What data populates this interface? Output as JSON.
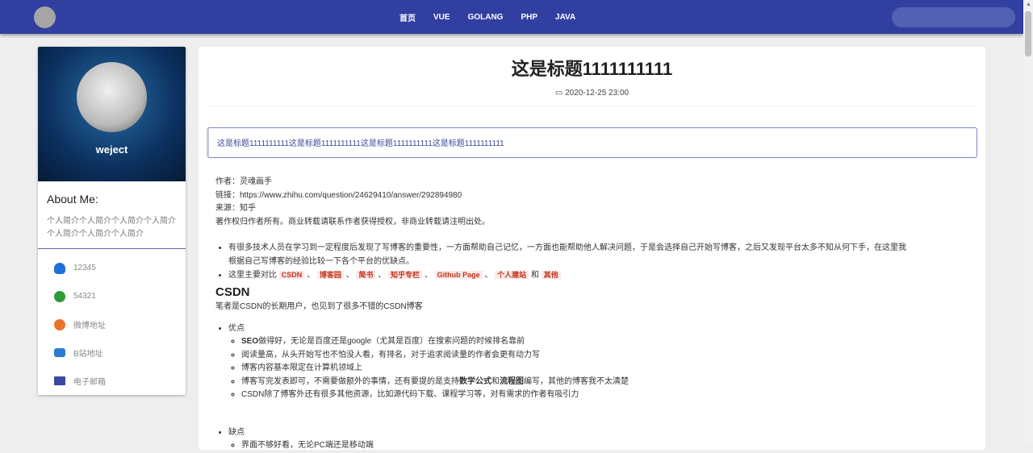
{
  "nav": {
    "items": [
      "首页",
      "VUE",
      "GOLANG",
      "PHP",
      "JAVA"
    ]
  },
  "sidebar": {
    "username": "weject",
    "about_title": "About Me:",
    "about_text": "个人简介个人简介个人简介个人简介个人简介个人简介个人简介",
    "links": [
      {
        "icon": "qq-icon",
        "label": "12345",
        "color": "#1e6fd9"
      },
      {
        "icon": "wechat-icon",
        "label": "54321",
        "color": "#2e9a3a"
      },
      {
        "icon": "weibo-icon",
        "label": "微博地址",
        "color": "#e8742b"
      },
      {
        "icon": "bilibili-icon",
        "label": "B站地址",
        "color": "#2a7bd1"
      },
      {
        "icon": "email-icon",
        "label": "电子邮箱",
        "color": "#3b4aa0"
      }
    ]
  },
  "article": {
    "title": "这是标题1111111111",
    "date": "2020-12-25 23:00",
    "summary": "这是标题1111111111这是标题1111111111这是标题1111111111这是标题1111111111",
    "meta": [
      "作者：灵魂画手",
      "链接：https://www.zhihu.com/question/24629410/answer/292894980",
      "来源：知乎",
      "著作权归作者所有。商业转载请联系作者获得授权，非商业转载请注明出处。"
    ],
    "intro": "有很多技术人员在学习到一定程度后发现了写博客的重要性，一方面帮助自己记忆，一方面也能帮助他人解决问题，于是会选择自己开始写博客，之后又发现平台太多不知从何下手，在这里我根据自己写博客的经验比较一下各个平台的优缺点。",
    "compare_prefix": "这里主要对比",
    "sep": "、",
    "and": "和",
    "platforms": [
      "CSDN",
      "博客园",
      "简书",
      "知乎专栏",
      "Github Page",
      "个人建站",
      "其他"
    ],
    "csdn_heading": "CSDN",
    "csdn_intro": "笔者是CSDN的长期用户，也见到了很多不错的CSDN博客",
    "pros_label": "优点",
    "pros": {
      "p1_bold": "SEO",
      "p1": "做得好，无论是百度还是google（尤其是百度）在搜索问题的时候排名靠前",
      "p2": "阅读量高，从头开始写也不怕没人看，有排名，对于追求阅读量的作者会更有动力写",
      "p3": "博客内容基本限定在计算机领域上",
      "p4a": "博客写完发表即可，不需要做额外的事情，还有要提的是支持",
      "p4b": "数学公式",
      "p4c": "和",
      "p4d": "流程图",
      "p4e": "编写，其他的博客我不太清楚",
      "p5": "CSDN除了博客外还有很多其他资源，比如源代码下载、课程学习等，对有需求的作者有吸引力"
    },
    "cons_label": "缺点",
    "cons": [
      "界面不够好看，无论PC端还是移动端"
    ]
  }
}
